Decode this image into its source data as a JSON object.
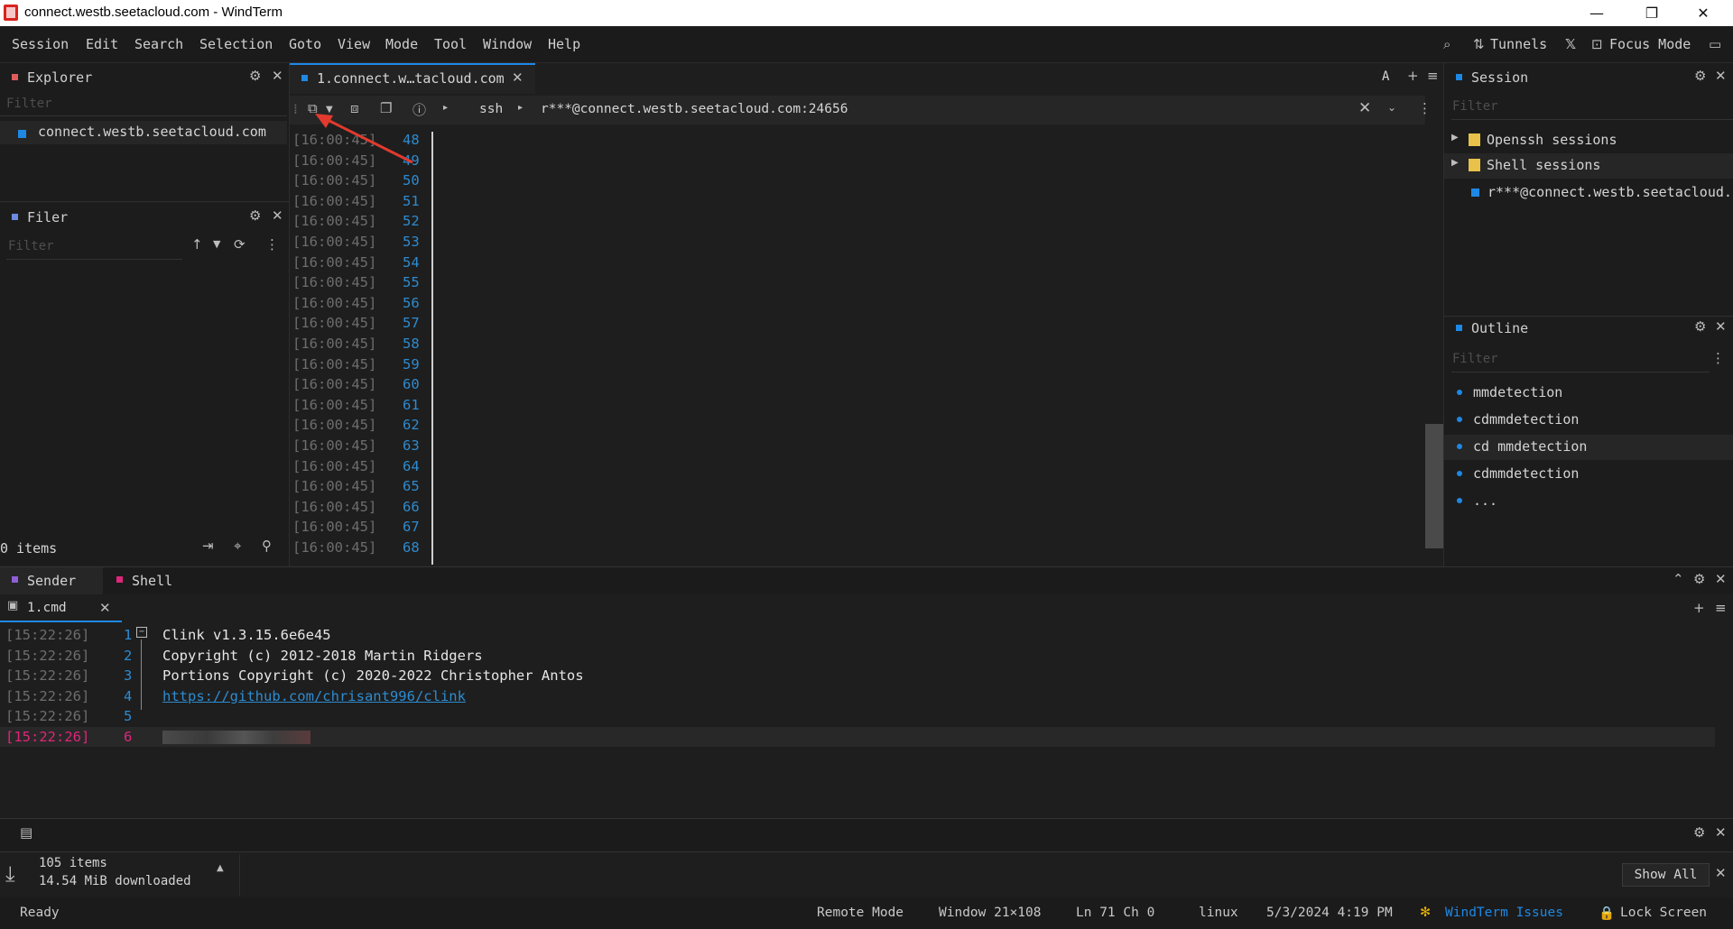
{
  "window": {
    "title": "connect.westb.seetacloud.com - WindTerm"
  },
  "menu": [
    "Session",
    "Edit",
    "Search",
    "Selection",
    "Goto",
    "View",
    "Mode",
    "Tool",
    "Window",
    "Help"
  ],
  "toolbar_right": {
    "tunnels": "Tunnels",
    "focus_mode": "Focus Mode"
  },
  "explorer": {
    "title": "Explorer",
    "filter_placeholder": "Filter",
    "items": [
      "connect.westb.seetacloud.com"
    ]
  },
  "filer": {
    "title": "Filer",
    "filter_placeholder": "Filter",
    "count": "0 items"
  },
  "editor": {
    "tab_label": "1.connect.w…tacloud.com",
    "tab_font_btn": "A",
    "ssh_protocol": "ssh",
    "ssh_address": "r***@connect.westb.seetacloud.com:24656",
    "terminal_lines": [
      {
        "ts": "[16:00:45]",
        "n": "48"
      },
      {
        "ts": "[16:00:45]",
        "n": "49"
      },
      {
        "ts": "[16:00:45]",
        "n": "50"
      },
      {
        "ts": "[16:00:45]",
        "n": "51"
      },
      {
        "ts": "[16:00:45]",
        "n": "52"
      },
      {
        "ts": "[16:00:45]",
        "n": "53"
      },
      {
        "ts": "[16:00:45]",
        "n": "54"
      },
      {
        "ts": "[16:00:45]",
        "n": "55"
      },
      {
        "ts": "[16:00:45]",
        "n": "56"
      },
      {
        "ts": "[16:00:45]",
        "n": "57"
      },
      {
        "ts": "[16:00:45]",
        "n": "58"
      },
      {
        "ts": "[16:00:45]",
        "n": "59"
      },
      {
        "ts": "[16:00:45]",
        "n": "60"
      },
      {
        "ts": "[16:00:45]",
        "n": "61"
      },
      {
        "ts": "[16:00:45]",
        "n": "62"
      },
      {
        "ts": "[16:00:45]",
        "n": "63"
      },
      {
        "ts": "[16:00:45]",
        "n": "64"
      },
      {
        "ts": "[16:00:45]",
        "n": "65"
      },
      {
        "ts": "[16:00:45]",
        "n": "66"
      },
      {
        "ts": "[16:00:45]",
        "n": "67"
      },
      {
        "ts": "[16:00:45]",
        "n": "68"
      }
    ]
  },
  "session_panel": {
    "title": "Session",
    "filter_placeholder": "Filter",
    "folders": [
      "Openssh sessions",
      "Shell sessions"
    ],
    "items": [
      "r***@connect.westb.seetacloud.c"
    ]
  },
  "outline_panel": {
    "title": "Outline",
    "filter_placeholder": "Filter",
    "items": [
      "mmdetection",
      "cdmmdetection",
      "cd mmdetection",
      "cdmmdetection",
      "..."
    ]
  },
  "bottom": {
    "tabs": [
      "Sender",
      "Shell"
    ],
    "cmd_tab": "1.cmd",
    "lines": [
      {
        "ts": "[15:22:26]",
        "n": "1",
        "text": "Clink v1.3.15.6e6e45"
      },
      {
        "ts": "[15:22:26]",
        "n": "2",
        "text": "Copyright (c) 2012-2018 Martin Ridgers"
      },
      {
        "ts": "[15:22:26]",
        "n": "3",
        "text": "Portions Copyright (c) 2020-2022 Christopher Antos"
      },
      {
        "ts": "[15:22:26]",
        "n": "4",
        "text": "https://github.com/chrisant996/clink"
      },
      {
        "ts": "[15:22:26]",
        "n": "5",
        "text": ""
      },
      {
        "ts": "[15:22:26]",
        "n": "6",
        "text": ""
      }
    ]
  },
  "downloads": {
    "count": "105 items",
    "size": "14.54 MiB downloaded",
    "show_all": "Show All"
  },
  "statusbar": {
    "ready": "Ready",
    "remote_mode": "Remote Mode",
    "window": "Window 21×108",
    "position": "Ln 71 Ch 0",
    "os": "linux",
    "datetime": "5/3/2024 4:19 PM",
    "issues": "WindTerm Issues",
    "lock": "Lock Screen"
  },
  "colors": {
    "accent_blue": "#1e88e5",
    "line_number": "#2d8bd0",
    "pink": "#e0257a",
    "annotation_arrow": "#e23a2e"
  }
}
